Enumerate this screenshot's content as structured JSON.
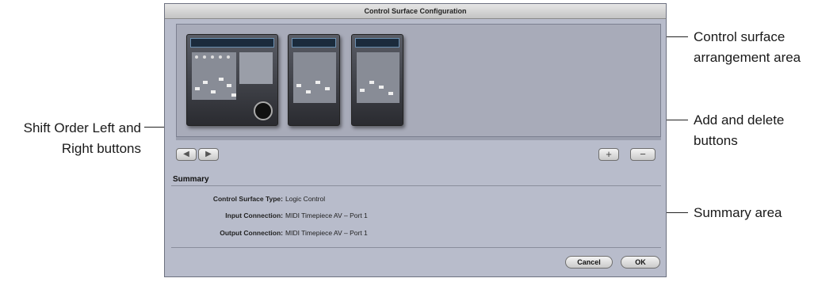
{
  "dialog": {
    "title": "Control Surface Configuration",
    "summary_heading": "Summary",
    "summary_rows": [
      {
        "label": "Control Surface Type:",
        "value": "Logic Control"
      },
      {
        "label": "Input Connection:",
        "value": "MIDI Timepiece AV – Port 1"
      },
      {
        "label": "Output Connection:",
        "value": "MIDI Timepiece AV – Port 1"
      }
    ],
    "buttons": {
      "shift_left": "◀",
      "shift_right": "▶",
      "add": "+",
      "delete": "−",
      "cancel": "Cancel",
      "ok": "OK"
    }
  },
  "callouts": {
    "arrangement_area_line1": "Control surface",
    "arrangement_area_line2": "arrangement area",
    "shift_order_line1": "Shift Order Left and",
    "shift_order_line2": "Right buttons",
    "add_delete_line1": "Add and delete",
    "add_delete_line2": "buttons",
    "summary_area": "Summary area"
  }
}
